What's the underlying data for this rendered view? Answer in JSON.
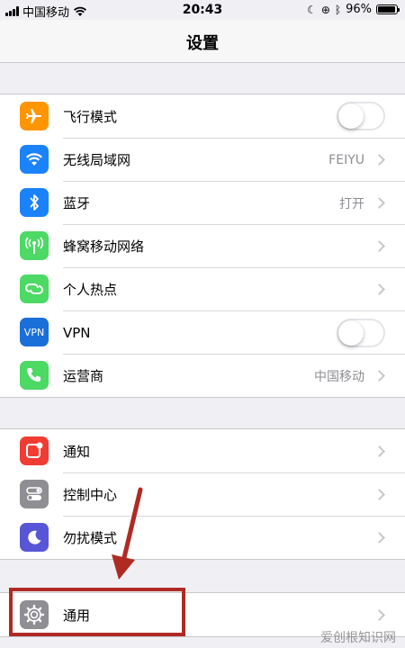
{
  "status_bar": {
    "carrier": "中国移动",
    "time": "20:43",
    "battery": "96%",
    "battery_level": 0.96
  },
  "nav": {
    "title": "设置"
  },
  "group1": [
    {
      "label": "飞行模式",
      "icon": "airplane-icon",
      "color": "#ff9500",
      "control": "toggle",
      "on": false
    },
    {
      "label": "无线局域网",
      "icon": "wifi-icon",
      "color": "#1a82fb",
      "detail": "FEIYU",
      "control": "chevron"
    },
    {
      "label": "蓝牙",
      "icon": "bluetooth-icon",
      "color": "#1a82fb",
      "detail": "打开",
      "control": "chevron"
    },
    {
      "label": "蜂窝移动网络",
      "icon": "cellular-icon",
      "color": "#4cd964",
      "control": "chevron"
    },
    {
      "label": "个人热点",
      "icon": "hotspot-icon",
      "color": "#4cd964",
      "control": "chevron"
    },
    {
      "label": "VPN",
      "icon": "vpn-icon",
      "color": "#1a6fd9",
      "control": "toggle",
      "on": false
    },
    {
      "label": "运营商",
      "icon": "phone-icon",
      "color": "#4cd964",
      "detail": "中国移动",
      "control": "chevron"
    }
  ],
  "group2": [
    {
      "label": "通知",
      "icon": "notification-icon",
      "color": "#f03c33",
      "control": "chevron"
    },
    {
      "label": "控制中心",
      "icon": "control-center-icon",
      "color": "#8e8e93",
      "control": "chevron"
    },
    {
      "label": "勿扰模式",
      "icon": "moon-icon",
      "color": "#5856d6",
      "control": "chevron"
    }
  ],
  "group3": [
    {
      "label": "通用",
      "icon": "gear-icon",
      "color": "#8e8e93",
      "control": "chevron"
    }
  ],
  "vpn_icon_text": "VPN",
  "watermark": "爱创根知识网",
  "annotation_color": "#b02a24"
}
